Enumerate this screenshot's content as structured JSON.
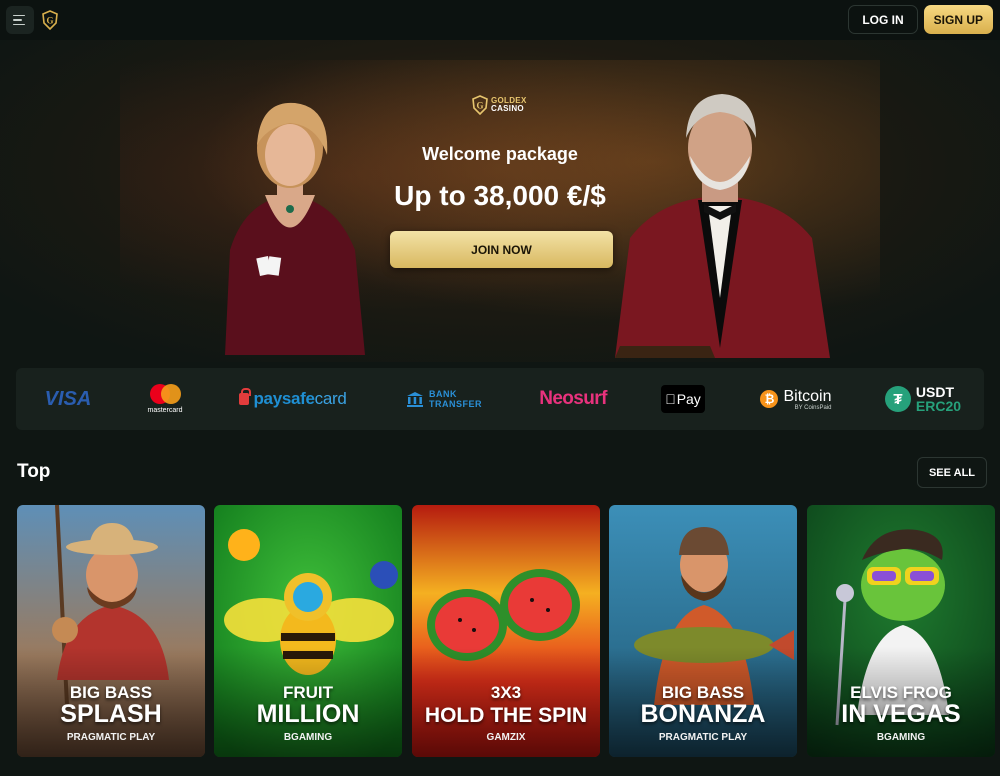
{
  "header": {
    "menu_icon": "hamburger-icon",
    "logo_icon": "goldex-shield-icon",
    "login_label": "LOG IN",
    "signup_label": "SIGN UP"
  },
  "hero": {
    "logo_line1": "GOLDEX",
    "logo_line2": "CASINO",
    "subtitle": "Welcome package",
    "title": "Up to 38,000 €/$",
    "cta_label": "JOIN NOW"
  },
  "payments": {
    "visa": "VISA",
    "mastercard": "mastercard",
    "paysafecard_a": "paysafe",
    "paysafecard_b": "card",
    "bank_line1": "BANK",
    "bank_line2": "TRANSFER",
    "neosurf": "Neosurf",
    "applepay": "Pay",
    "bitcoin": "Bitcoin",
    "bitcoin_by": "BY CoinsPaid",
    "usdt_line1": "USDT",
    "usdt_line2": "ERC20"
  },
  "top": {
    "title": "Top",
    "see_all_label": "SEE ALL",
    "games": [
      {
        "line1": "BIG BASS",
        "line2": "SPLASH",
        "provider": "PRAGMATIC PLAY"
      },
      {
        "line1": "FRUIT",
        "line2": "MILLION",
        "provider": "BGAMING"
      },
      {
        "line1": "3X3",
        "line2": "HOLD THE SPIN",
        "provider": "GAMZIX"
      },
      {
        "line1": "BIG BASS",
        "line2": "BONANZA",
        "provider": "PRAGMATIC PLAY"
      },
      {
        "line1": "ELVIS FROG",
        "line2": "IN VEGAS",
        "provider": "BGAMING"
      }
    ]
  },
  "colors": {
    "background": "#0f1613",
    "gold": "#e7c56e",
    "panel": "#18211d"
  }
}
